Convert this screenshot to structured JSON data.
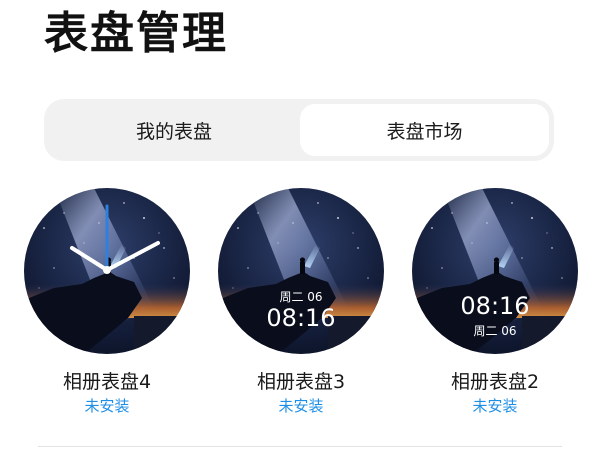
{
  "page": {
    "title": "表盘管理"
  },
  "tabs": [
    {
      "label": "我的表盘",
      "selected": false
    },
    {
      "label": "表盘市场",
      "selected": true
    }
  ],
  "faces": [
    {
      "name": "相册表盘4",
      "status": "未安装",
      "style": "analog"
    },
    {
      "name": "相册表盘3",
      "status": "未安装",
      "style": "digital-date-top",
      "date": "周二 06",
      "time": "08:16"
    },
    {
      "name": "相册表盘2",
      "status": "未安装",
      "style": "digital-date-bottom",
      "date": "周二 06",
      "time": "08:16"
    }
  ],
  "colors": {
    "status_blue": "#1f8fe6",
    "minute_hand": "#2f7fe0",
    "sky_dark": "#0e1630"
  }
}
